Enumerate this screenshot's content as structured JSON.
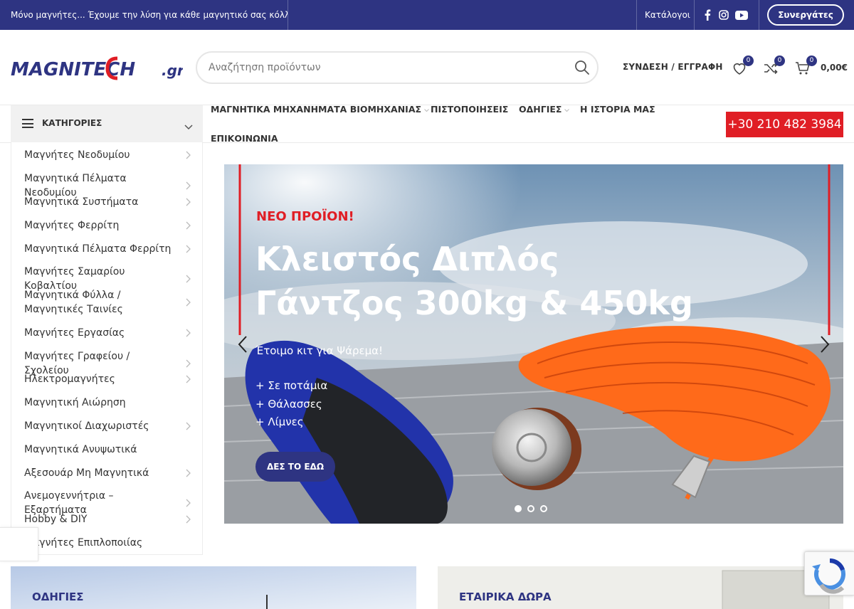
{
  "topbar": {
    "promo": "Μόνο μαγνήτες... Έχουμε την λύση για κάθε μαγνητικό σας κόλλημα!",
    "catalogs_link": "Κατάλογοι",
    "social_icons": [
      "facebook-icon",
      "instagram-icon",
      "youtube-icon"
    ],
    "partner_button": "Συνεργάτες"
  },
  "header": {
    "logo_text": "MAGNITECH",
    "logo_suffix": ".gr",
    "search_placeholder": "Αναζήτηση προϊόντων",
    "login_label": "ΣΥΝΔΕΣΗ / ΕΓΓΡΑΦΗ",
    "wishlist_count": "0",
    "compare_count": "0",
    "cart_count": "0",
    "cart_total": "0,00€"
  },
  "categories": {
    "title": "ΚΑΤΗΓΟΡΙΕΣ",
    "items": [
      "Μαγνήτες Νεοδυμίου",
      "Μαγνητικά Πέλματα Νεοδυμίου",
      "Μαγνητικά Συστήματα",
      "Μαγνήτες Φερρίτη",
      "Μαγνητικά Πέλματα Φερρίτη",
      "Μαγνήτες Σαμαρίου Κοβαλτίου",
      "Μαγνητικά Φύλλα / Μαγνητικές Ταινίες",
      "Μαγνήτες Εργασίας",
      "Μαγνήτες Γραφείου / Σχολείου",
      "Ηλεκτρομαγνήτες",
      "Μαγνητική Αιώρηση",
      "Μαγνητικοί Διαχωριστές",
      "Μαγνητικά Ανυψωτικά",
      "Αξεσουάρ Μη Μαγνητικά",
      "Ανεμογεννήτρια – Εξαρτήματα",
      "Hobby & DIY",
      "Μαγνήτες Επιπλοποιίας"
    ]
  },
  "nav": {
    "items": [
      "ΜΑΓΝΗΤΙΚΑ ΜΗΧΑΝΗΜΑΤΑ ΒΙΟΜΗΧΑΝΙΑΣ",
      "ΠΙΣΤΟΠΟΙΗΣΕΙΣ",
      "ΟΔΗΓΙΕΣ",
      "Η ΙΣΤΟΡΙΑ ΜΑΣ",
      "ΕΠΙΚΟΙΝΩΝΙΑ"
    ],
    "phone": "+30 210 482 3984"
  },
  "hero": {
    "tag": "ΝΕΟ ΠΡΟΪΟΝ!",
    "headline_line1": "Κλειστός Διπλός",
    "headline_line2": "Γάντζος 300kg & 450kg",
    "subtitle": "Έτοιμο κιτ για Ψάρεμα!",
    "bullets": [
      "+ Σε ποτάμια",
      "+ Θάλασσες",
      "+ Λίμνες"
    ],
    "cta": "ΔΕΣ ΤΟ ΕΔΩ",
    "slide_count": 3,
    "active_slide": 1
  },
  "banners": {
    "left_label": "ΟΔΗΓΙΕΣ",
    "right_label": "ΕΤΑΙΡΙΚΑ ΔΩΡΑ"
  },
  "colors": {
    "brand_blue": "#2e3482",
    "brand_red": "#e01e25"
  }
}
